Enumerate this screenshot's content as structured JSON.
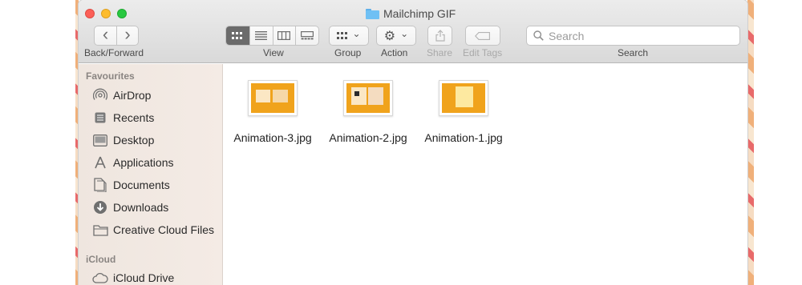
{
  "window": {
    "title": "Mailchimp GIF"
  },
  "toolbar": {
    "back_forward_label": "Back/Forward",
    "view_label": "View",
    "group_label": "Group",
    "action_label": "Action",
    "share_label": "Share",
    "edit_tags_label": "Edit Tags",
    "search_label": "Search",
    "search_placeholder": "Search",
    "back_glyph": "‹",
    "forward_glyph": "›",
    "chevron_glyph": "⌄",
    "gear_glyph": "⚙"
  },
  "sidebar": {
    "favourites_header": "Favourites",
    "icloud_header": "iCloud",
    "items": [
      {
        "label": "AirDrop",
        "icon": "airdrop-icon"
      },
      {
        "label": "Recents",
        "icon": "recents-icon"
      },
      {
        "label": "Desktop",
        "icon": "desktop-icon"
      },
      {
        "label": "Applications",
        "icon": "applications-icon"
      },
      {
        "label": "Documents",
        "icon": "documents-icon"
      },
      {
        "label": "Downloads",
        "icon": "downloads-icon"
      },
      {
        "label": "Creative Cloud Files",
        "icon": "folder-icon"
      }
    ],
    "icloud_items": [
      {
        "label": "iCloud Drive",
        "icon": "cloud-icon"
      }
    ]
  },
  "files": [
    {
      "name": "Animation-3.jpg",
      "thumb_color": "#f0a31c"
    },
    {
      "name": "Animation-2.jpg",
      "thumb_color": "#f0a31c"
    },
    {
      "name": "Animation-1.jpg",
      "thumb_color": "#f0a31c"
    }
  ],
  "colors": {
    "close": "#fc5f57",
    "minimize": "#fdbc2e",
    "maximize": "#28c840",
    "folder": "#6fc0f4"
  }
}
